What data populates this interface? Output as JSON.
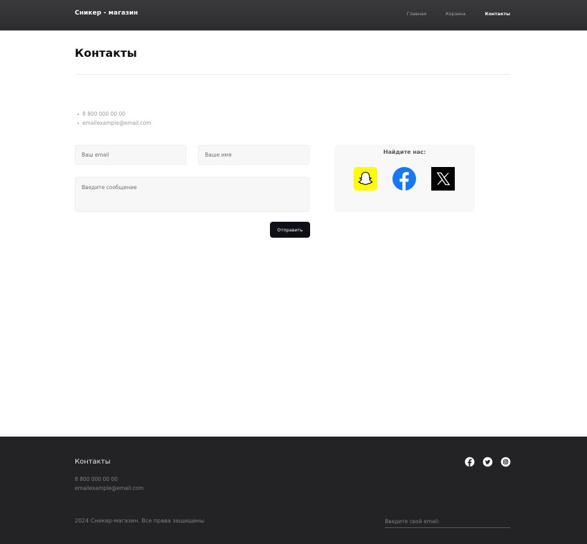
{
  "header": {
    "logo": "Сникер - магазин",
    "nav": [
      {
        "label": "Главная"
      },
      {
        "label": "Корзина"
      },
      {
        "label": "Контакты"
      }
    ]
  },
  "main": {
    "title": "Контакты",
    "contacts": {
      "phone": "8 800 000 00 00",
      "email": "emailexample@email.com"
    },
    "form": {
      "email_placeholder": "Ваш email",
      "name_placeholder": "Ваше имя",
      "message_placeholder": "Введите сообщение",
      "submit_label": "Отправить"
    },
    "find_us": {
      "title": "Найдите нас:",
      "networks": [
        "snapchat-icon",
        "facebook-icon",
        "x-icon"
      ]
    }
  },
  "footer": {
    "heading": "Контакты",
    "phone": "8 800 000 00 00",
    "email": "emailexample@email.com",
    "copyright": "2024 Сникер-магазин. Все права защищены",
    "subscribe_placeholder": "Введите свой email:",
    "icons": [
      "facebook-icon",
      "twitter-icon",
      "instagram-icon"
    ]
  },
  "colors": {
    "header_bg": "#323234",
    "footer_bg": "#232326",
    "button_bg": "#0f0f17",
    "snapchat": "#FFFC00",
    "facebook": "#1877F2"
  }
}
